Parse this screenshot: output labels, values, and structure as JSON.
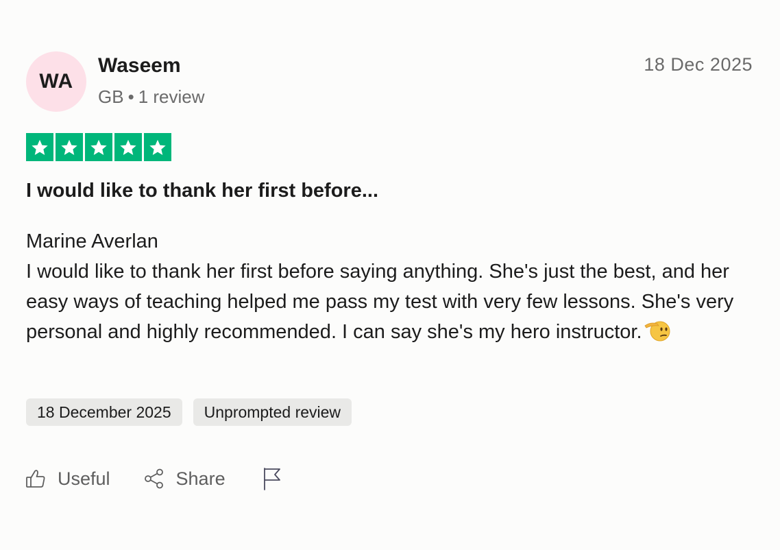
{
  "reviewer": {
    "initials": "WA",
    "name": "Waseem",
    "country": "GB",
    "separator": "•",
    "review_count": "1 review",
    "avatar_color": "#fde0e8"
  },
  "review": {
    "date": "18 Dec 2025",
    "rating": 5,
    "rating_max": 5,
    "star_color": "#00b67a",
    "title": "I would like to thank her first before...",
    "body": "Marine Averlan\nI would like to thank her first before saying anything. She's just the best, and her easy ways of teaching helped me pass my test with very few lessons. She's very personal and highly recommended. I can say she's my hero instructor.",
    "emoji": "saluting-face-emoji"
  },
  "chips": {
    "date": "18 December 2025",
    "type": "Unprompted review",
    "chip_color": "#e9e9e7"
  },
  "actions": {
    "useful_label": "Useful",
    "share_label": "Share",
    "useful_icon": "thumbs-up-icon",
    "share_icon": "share-icon",
    "report_icon": "flag-icon"
  }
}
